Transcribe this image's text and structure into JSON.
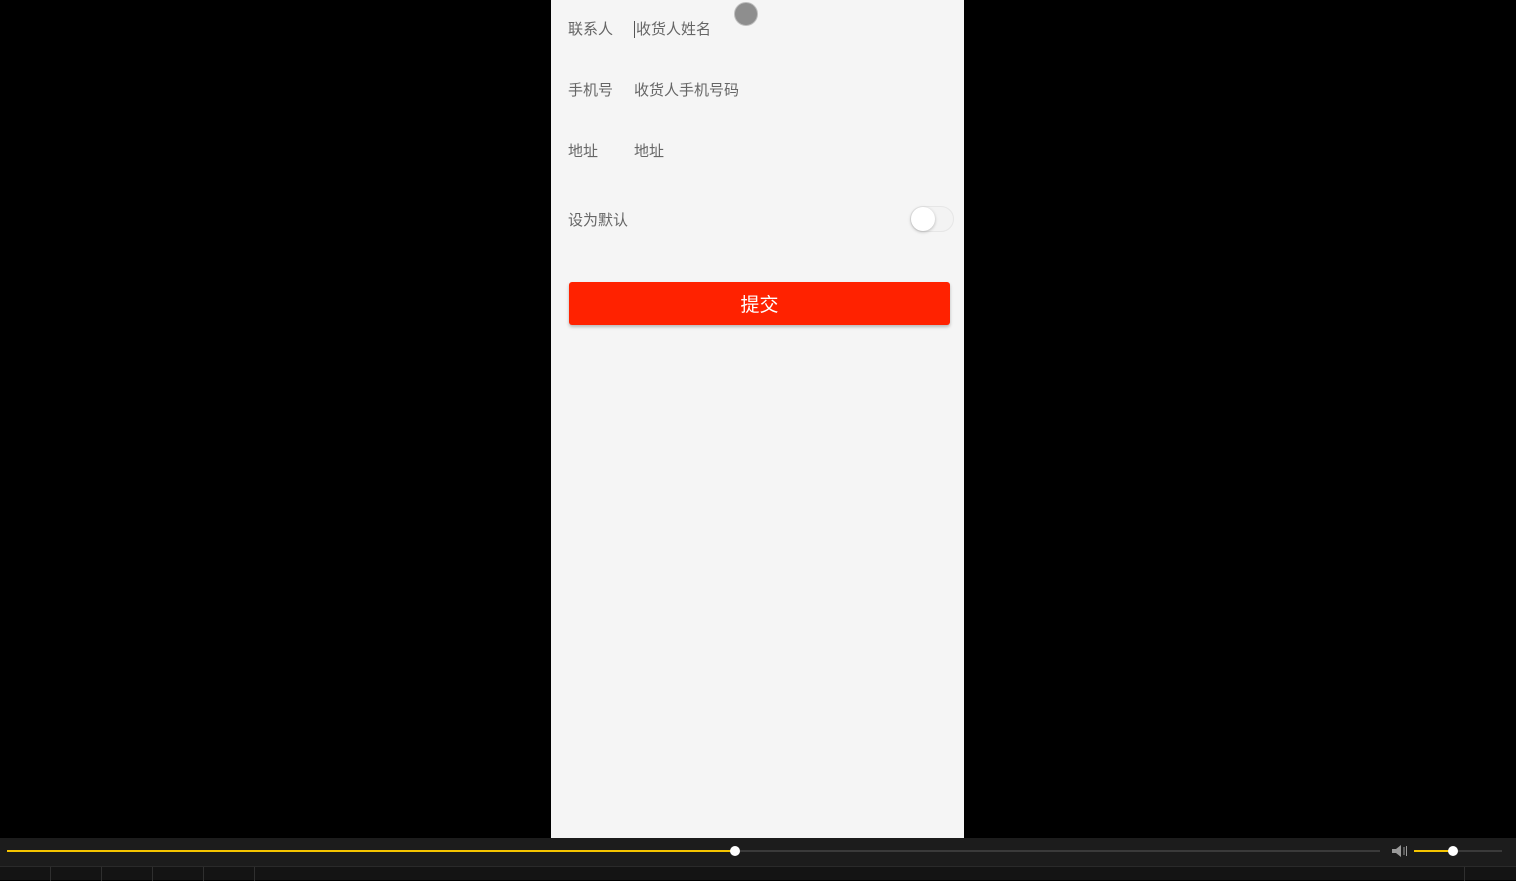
{
  "form": {
    "contact_label": "联系人",
    "contact_placeholder": "收货人姓名",
    "phone_label": "手机号",
    "phone_placeholder": "收货人手机号码",
    "address_label": "地址",
    "address_placeholder": "地址",
    "default_label": "设为默认",
    "default_on": false,
    "submit_label": "提交"
  },
  "player": {
    "progress_fraction": 0.53,
    "volume_fraction": 0.44
  },
  "colors": {
    "accent": "#ff2200",
    "player_accent": "#f5c400"
  },
  "icons": {
    "volume": "speaker-icon"
  }
}
